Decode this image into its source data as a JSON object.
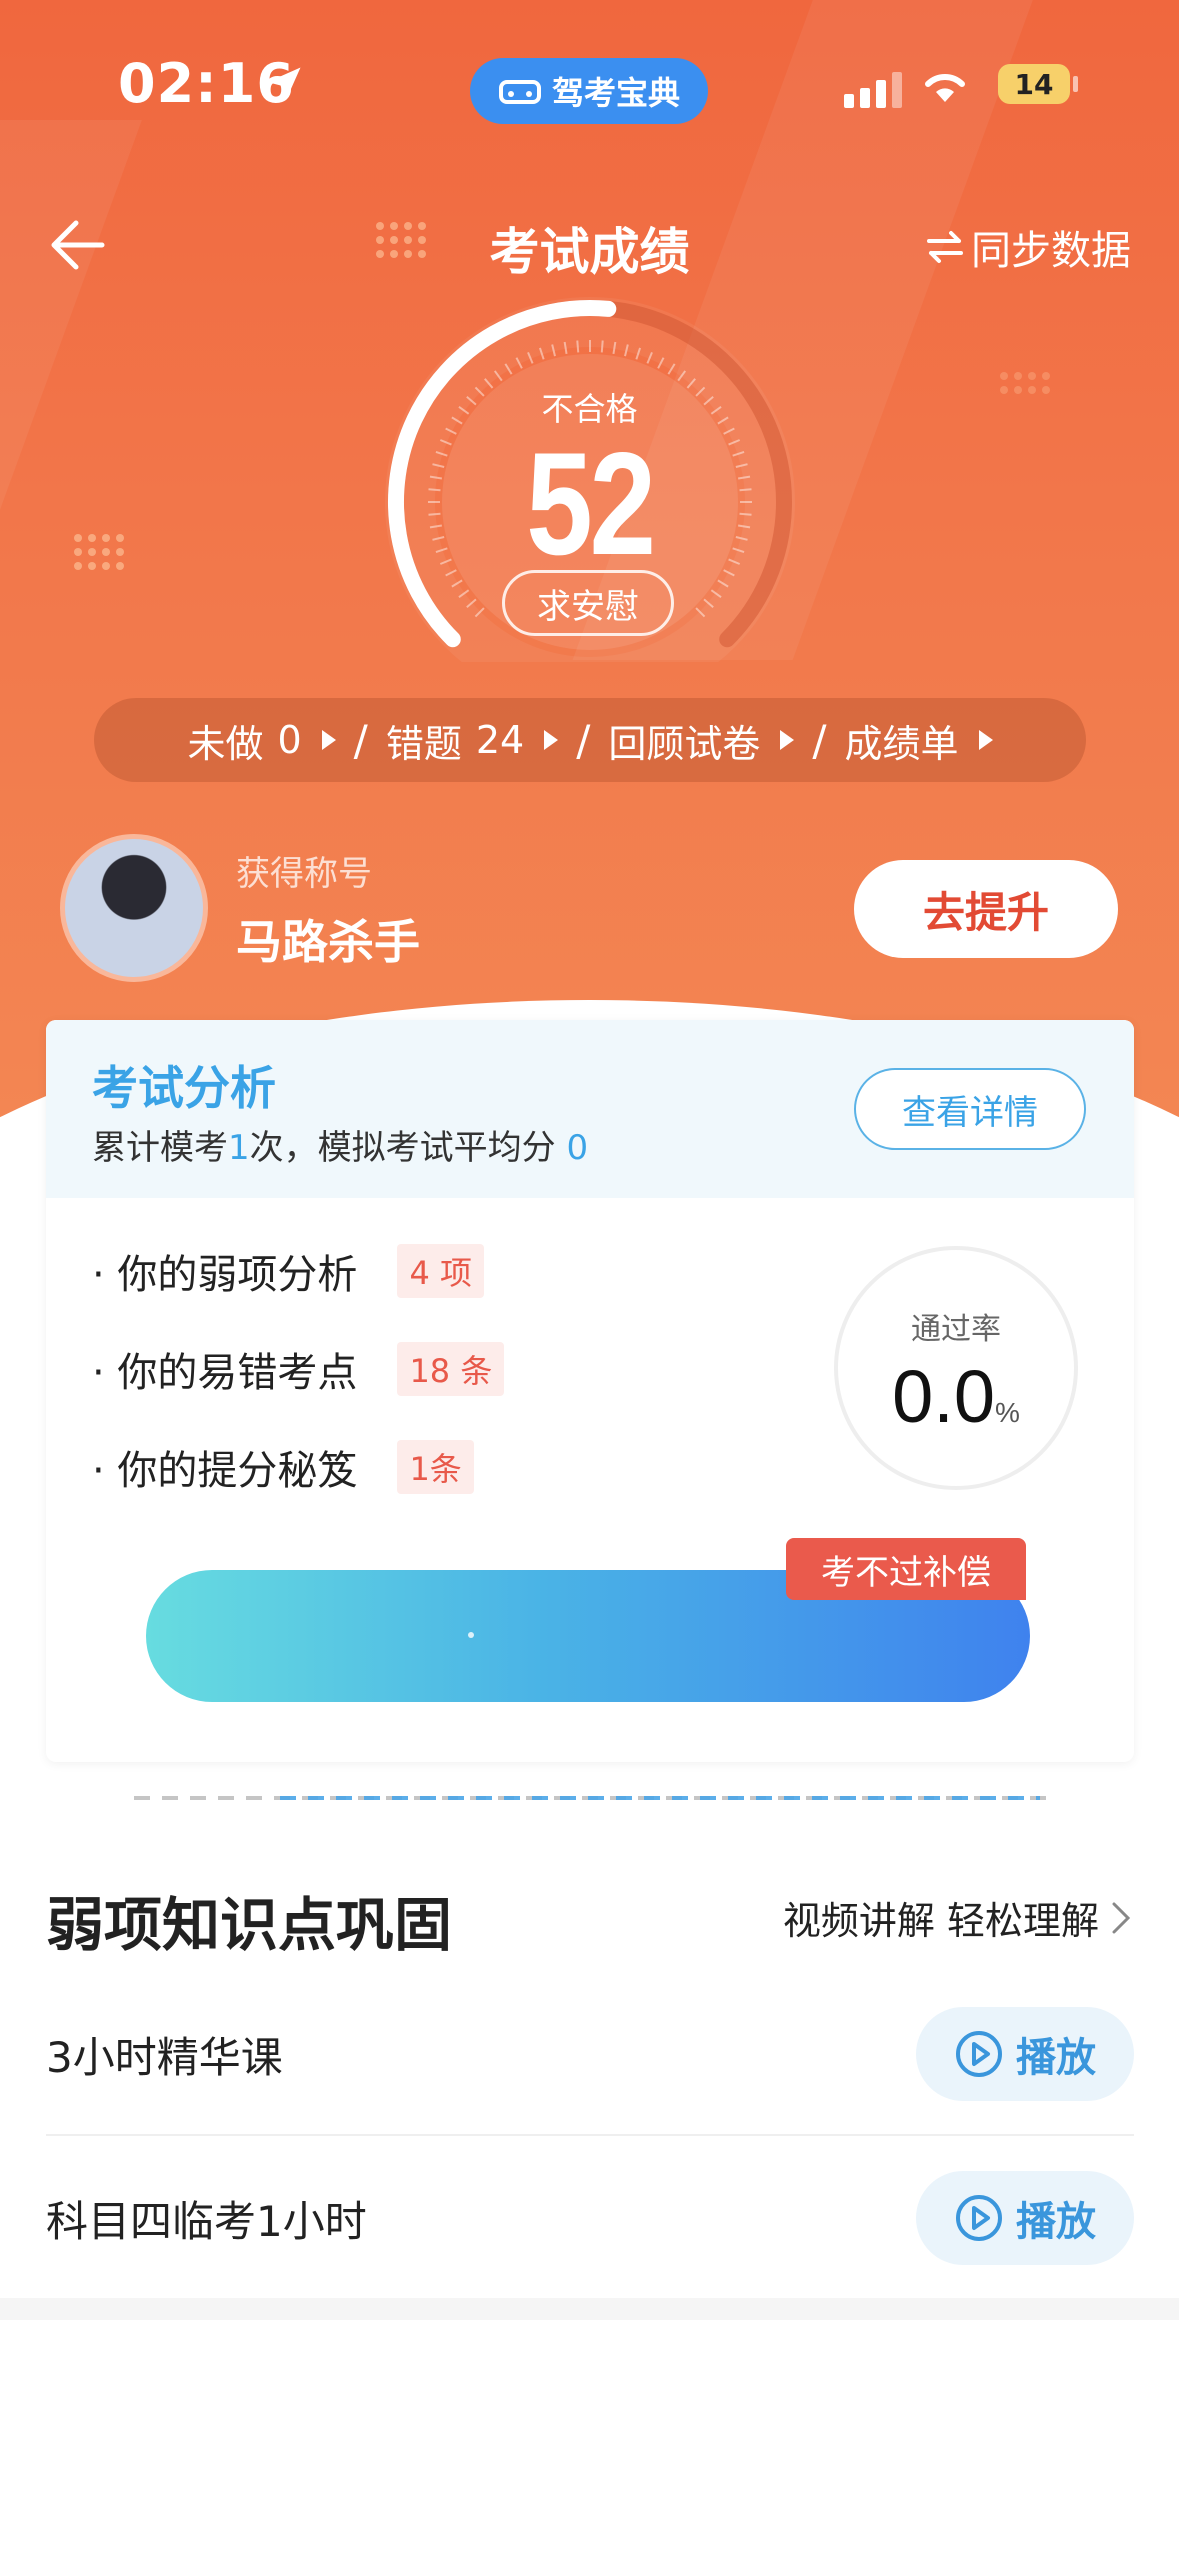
{
  "status_bar": {
    "time": "02:16",
    "app_name": "驾考宝典",
    "battery": "14"
  },
  "nav": {
    "title": "考试成绩",
    "sync_label": "同步数据"
  },
  "result": {
    "status": "不合格",
    "score": "52",
    "score_fraction": 0.52,
    "comfort_label": "求安慰"
  },
  "links": [
    {
      "label": "未做",
      "value": "0"
    },
    {
      "label": "错题",
      "value": "24"
    },
    {
      "label": "回顾试卷",
      "value": ""
    },
    {
      "label": "成绩单",
      "value": ""
    }
  ],
  "profile": {
    "title_label": "获得称号",
    "title_value": "马路杀手",
    "improve_label": "去提升"
  },
  "analysis": {
    "title": "考试分析",
    "sub_prefix": "累计模考",
    "exam_count": "1",
    "sub_middle": "次，模拟考试平均分",
    "avg_score": "0",
    "detail_label": "查看详情",
    "items": [
      {
        "label": "· 你的弱项分析",
        "badge": "4 项"
      },
      {
        "label": "· 你的易错考点",
        "badge": "18 条"
      },
      {
        "label": "· 你的提分秘笈",
        "badge": "1条"
      }
    ],
    "pass_rate_label": "通过率",
    "pass_rate_value": "0.0",
    "pass_rate_unit": "%",
    "compensation_label": "考不过补偿"
  },
  "weak_points": {
    "title": "弱项知识点巩固",
    "link_label": "视频讲解 轻松理解",
    "courses": [
      {
        "name": "3小时精华课",
        "button": "播放"
      },
      {
        "name": "科目四临考1小时",
        "button": "播放"
      }
    ]
  },
  "colors": {
    "hero": "#f0673e",
    "accent_blue": "#3aa3e6",
    "danger": "#e24a34"
  }
}
